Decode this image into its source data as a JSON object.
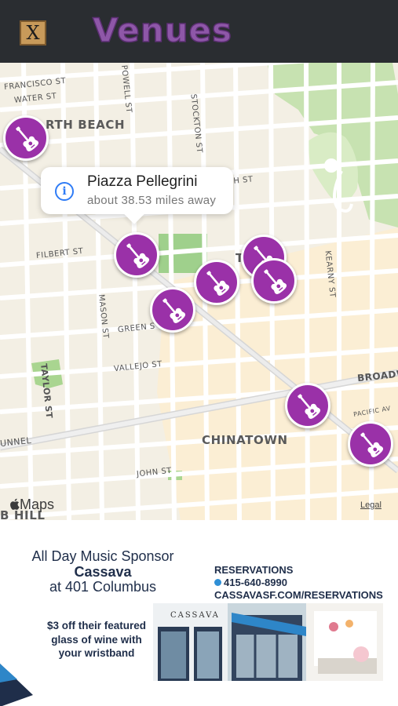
{
  "header": {
    "close_icon_glyph": "X",
    "title": "Venues",
    "title_color": "#8e57a8",
    "background": "#2a2d31"
  },
  "map": {
    "streets": {
      "francisco": "FRANCISCO ST",
      "water": "WATER ST",
      "powell": "POWELL ST",
      "stockton": "STOCKTON ST",
      "filbert": "FILBERT ST",
      "mason": "MASON ST",
      "green": "GREEN S",
      "vallejo": "VALLEJO ST",
      "taylor": "TAYLOR ST",
      "broadway": "BROADW",
      "tunnel": "UNNEL",
      "john": "JOHN ST",
      "kearny": "KEARNY ST",
      "pacific": "PACIFIC AV",
      "ch_st": "CH ST"
    },
    "districts": {
      "north_beach": "RTH BEACH",
      "telegraph": "T    PH",
      "chinatown": "CHINATOWN",
      "nob_hill": "B HILL"
    },
    "callout": {
      "name": "Piazza Pellegrini",
      "distance": "about 38.53 miles away",
      "icon": "info-icon"
    },
    "pin_icon": "guitar-icon",
    "pin_color": "#9a31a8",
    "maps_label": "Maps",
    "legal_label": "Legal"
  },
  "ad": {
    "line1": "All Day Music Sponsor",
    "line2": "Cassava",
    "line3": "at 401 Columbus",
    "reservations_title": "RESERVATIONS",
    "phone": "415-640-8990",
    "url": "CASSAVASF.COM/RESERVATIONS",
    "offer": "$3 off their featured glass of wine with your wristband",
    "storefront_sign": "CASSAVA",
    "text_color": "#1f2e4a"
  }
}
